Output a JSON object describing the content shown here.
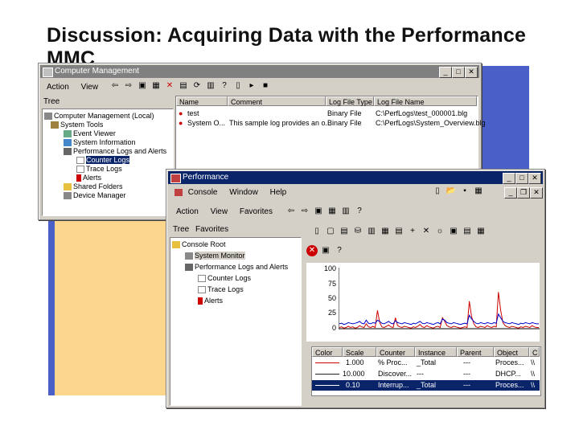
{
  "slide": {
    "title": "Discussion: Acquiring Data with the Performance MMC"
  },
  "cm_window": {
    "title": "Computer Management",
    "menu": [
      "Action",
      "View"
    ],
    "tree_tab": "Tree",
    "tree": [
      "Computer Management (Local)",
      "System Tools",
      "Event Viewer",
      "System Information",
      "Performance Logs and Alerts",
      "Counter Logs",
      "Trace Logs",
      "Alerts",
      "Shared Folders",
      "Device Manager"
    ],
    "columns": [
      "Name",
      "Comment",
      "Log File Type",
      "Log File Name"
    ],
    "rows": [
      [
        "test",
        "",
        "Binary File",
        "C:\\PerfLogs\\test_000001.blg"
      ],
      [
        "System O...",
        "This sample log provides an o...",
        "Binary File",
        "C:\\PerfLogs\\System_Overview.blg"
      ]
    ]
  },
  "perf_window": {
    "title": "Performance",
    "menu": [
      "Console",
      "Window",
      "Help"
    ],
    "submenu": [
      "Action",
      "View",
      "Favorites"
    ],
    "tabs": [
      "Tree",
      "Favorites"
    ],
    "tree": [
      "Console Root",
      "System Monitor",
      "Performance Logs and Alerts",
      "Counter Logs",
      "Trace Logs",
      "Alerts"
    ],
    "y_axis": [
      "100",
      "75",
      "50",
      "25",
      "0"
    ],
    "legend_columns": [
      "Color",
      "Scale",
      "Counter",
      "Instance",
      "Parent",
      "Object",
      "C"
    ],
    "legend_rows": [
      {
        "color": "#cc0000",
        "scale": "1.000",
        "counter": "% Proc...",
        "instance": "_Total",
        "parent": "---",
        "object": "Proces...",
        "c": "\\\\"
      },
      {
        "color": "#222222",
        "scale": "10.000",
        "counter": "Discover...",
        "instance": "---",
        "parent": "---",
        "object": "DHCP...",
        "c": "\\\\"
      },
      {
        "color": "#0000cc",
        "scale": "0.10",
        "counter": "Interrup...",
        "instance": "_Total",
        "parent": "---",
        "object": "Proces...",
        "c": "\\\\"
      }
    ],
    "series": {
      "red": [
        2,
        3,
        1,
        2,
        4,
        2,
        3,
        1,
        2,
        5,
        3,
        2,
        8,
        3,
        2,
        4,
        2,
        30,
        10,
        3,
        2,
        4,
        6,
        3,
        2,
        18,
        5,
        3,
        2,
        4,
        3,
        2,
        1,
        3,
        2,
        4,
        7,
        3,
        2,
        5,
        3,
        2,
        1,
        3,
        4,
        2,
        18,
        12,
        5,
        3,
        2,
        4,
        3,
        2,
        1,
        2,
        3,
        2,
        45,
        20,
        8,
        3,
        2,
        4,
        3,
        2,
        5,
        3,
        2,
        4,
        3,
        60,
        30,
        10,
        5,
        3,
        2,
        4,
        3,
        2,
        1,
        3,
        2,
        4,
        3,
        2,
        5,
        3,
        2,
        2
      ],
      "blue": [
        8,
        9,
        7,
        8,
        10,
        9,
        8,
        9,
        10,
        12,
        9,
        8,
        14,
        9,
        8,
        10,
        9,
        14,
        12,
        9,
        8,
        10,
        12,
        9,
        8,
        13,
        10,
        9,
        8,
        10,
        9,
        8,
        7,
        9,
        8,
        10,
        12,
        9,
        8,
        10,
        9,
        8,
        7,
        9,
        10,
        8,
        16,
        14,
        10,
        9,
        8,
        10,
        9,
        8,
        7,
        8,
        9,
        8,
        22,
        16,
        12,
        9,
        8,
        10,
        9,
        8,
        10,
        9,
        8,
        10,
        9,
        24,
        18,
        12,
        10,
        9,
        8,
        10,
        9,
        8,
        7,
        9,
        8,
        10,
        9,
        8,
        10,
        9,
        8,
        8
      ]
    }
  }
}
